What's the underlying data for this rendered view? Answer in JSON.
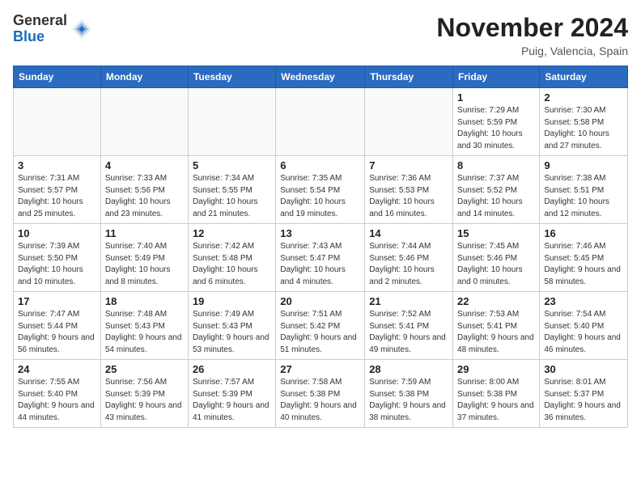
{
  "header": {
    "logo_general": "General",
    "logo_blue": "Blue",
    "month_title": "November 2024",
    "location": "Puig, Valencia, Spain"
  },
  "calendar": {
    "days_of_week": [
      "Sunday",
      "Monday",
      "Tuesday",
      "Wednesday",
      "Thursday",
      "Friday",
      "Saturday"
    ],
    "weeks": [
      [
        {
          "day": "",
          "info": ""
        },
        {
          "day": "",
          "info": ""
        },
        {
          "day": "",
          "info": ""
        },
        {
          "day": "",
          "info": ""
        },
        {
          "day": "",
          "info": ""
        },
        {
          "day": "1",
          "info": "Sunrise: 7:29 AM\nSunset: 5:59 PM\nDaylight: 10 hours and 30 minutes."
        },
        {
          "day": "2",
          "info": "Sunrise: 7:30 AM\nSunset: 5:58 PM\nDaylight: 10 hours and 27 minutes."
        }
      ],
      [
        {
          "day": "3",
          "info": "Sunrise: 7:31 AM\nSunset: 5:57 PM\nDaylight: 10 hours and 25 minutes."
        },
        {
          "day": "4",
          "info": "Sunrise: 7:33 AM\nSunset: 5:56 PM\nDaylight: 10 hours and 23 minutes."
        },
        {
          "day": "5",
          "info": "Sunrise: 7:34 AM\nSunset: 5:55 PM\nDaylight: 10 hours and 21 minutes."
        },
        {
          "day": "6",
          "info": "Sunrise: 7:35 AM\nSunset: 5:54 PM\nDaylight: 10 hours and 19 minutes."
        },
        {
          "day": "7",
          "info": "Sunrise: 7:36 AM\nSunset: 5:53 PM\nDaylight: 10 hours and 16 minutes."
        },
        {
          "day": "8",
          "info": "Sunrise: 7:37 AM\nSunset: 5:52 PM\nDaylight: 10 hours and 14 minutes."
        },
        {
          "day": "9",
          "info": "Sunrise: 7:38 AM\nSunset: 5:51 PM\nDaylight: 10 hours and 12 minutes."
        }
      ],
      [
        {
          "day": "10",
          "info": "Sunrise: 7:39 AM\nSunset: 5:50 PM\nDaylight: 10 hours and 10 minutes."
        },
        {
          "day": "11",
          "info": "Sunrise: 7:40 AM\nSunset: 5:49 PM\nDaylight: 10 hours and 8 minutes."
        },
        {
          "day": "12",
          "info": "Sunrise: 7:42 AM\nSunset: 5:48 PM\nDaylight: 10 hours and 6 minutes."
        },
        {
          "day": "13",
          "info": "Sunrise: 7:43 AM\nSunset: 5:47 PM\nDaylight: 10 hours and 4 minutes."
        },
        {
          "day": "14",
          "info": "Sunrise: 7:44 AM\nSunset: 5:46 PM\nDaylight: 10 hours and 2 minutes."
        },
        {
          "day": "15",
          "info": "Sunrise: 7:45 AM\nSunset: 5:46 PM\nDaylight: 10 hours and 0 minutes."
        },
        {
          "day": "16",
          "info": "Sunrise: 7:46 AM\nSunset: 5:45 PM\nDaylight: 9 hours and 58 minutes."
        }
      ],
      [
        {
          "day": "17",
          "info": "Sunrise: 7:47 AM\nSunset: 5:44 PM\nDaylight: 9 hours and 56 minutes."
        },
        {
          "day": "18",
          "info": "Sunrise: 7:48 AM\nSunset: 5:43 PM\nDaylight: 9 hours and 54 minutes."
        },
        {
          "day": "19",
          "info": "Sunrise: 7:49 AM\nSunset: 5:43 PM\nDaylight: 9 hours and 53 minutes."
        },
        {
          "day": "20",
          "info": "Sunrise: 7:51 AM\nSunset: 5:42 PM\nDaylight: 9 hours and 51 minutes."
        },
        {
          "day": "21",
          "info": "Sunrise: 7:52 AM\nSunset: 5:41 PM\nDaylight: 9 hours and 49 minutes."
        },
        {
          "day": "22",
          "info": "Sunrise: 7:53 AM\nSunset: 5:41 PM\nDaylight: 9 hours and 48 minutes."
        },
        {
          "day": "23",
          "info": "Sunrise: 7:54 AM\nSunset: 5:40 PM\nDaylight: 9 hours and 46 minutes."
        }
      ],
      [
        {
          "day": "24",
          "info": "Sunrise: 7:55 AM\nSunset: 5:40 PM\nDaylight: 9 hours and 44 minutes."
        },
        {
          "day": "25",
          "info": "Sunrise: 7:56 AM\nSunset: 5:39 PM\nDaylight: 9 hours and 43 minutes."
        },
        {
          "day": "26",
          "info": "Sunrise: 7:57 AM\nSunset: 5:39 PM\nDaylight: 9 hours and 41 minutes."
        },
        {
          "day": "27",
          "info": "Sunrise: 7:58 AM\nSunset: 5:38 PM\nDaylight: 9 hours and 40 minutes."
        },
        {
          "day": "28",
          "info": "Sunrise: 7:59 AM\nSunset: 5:38 PM\nDaylight: 9 hours and 38 minutes."
        },
        {
          "day": "29",
          "info": "Sunrise: 8:00 AM\nSunset: 5:38 PM\nDaylight: 9 hours and 37 minutes."
        },
        {
          "day": "30",
          "info": "Sunrise: 8:01 AM\nSunset: 5:37 PM\nDaylight: 9 hours and 36 minutes."
        }
      ]
    ]
  }
}
